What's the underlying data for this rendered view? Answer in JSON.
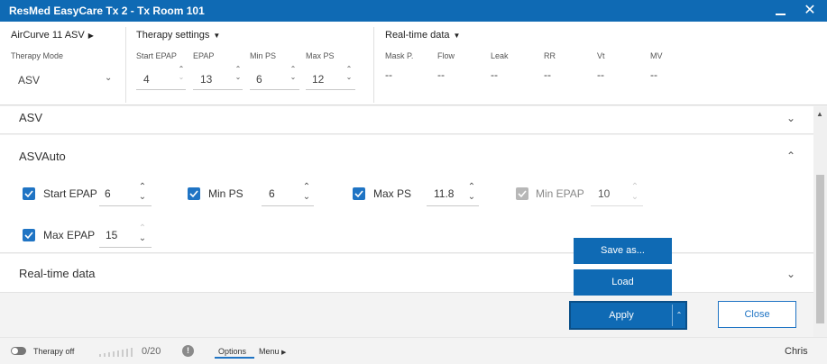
{
  "window": {
    "title": "ResMed EasyCare Tx 2 - Tx Room 101",
    "minimize": "_",
    "close": "✕"
  },
  "device": {
    "name": "AirCurve 11 ASV",
    "therapy_mode_label": "Therapy Mode",
    "therapy_mode_value": "ASV"
  },
  "therapy_settings": {
    "label": "Therapy settings",
    "fields": [
      {
        "label": "Start EPAP",
        "value": "4"
      },
      {
        "label": "EPAP",
        "value": "13"
      },
      {
        "label": "Min PS",
        "value": "6"
      },
      {
        "label": "Max PS",
        "value": "12"
      }
    ]
  },
  "realtime": {
    "label": "Real-time data",
    "columns": [
      {
        "label": "Mask P.",
        "value": "--"
      },
      {
        "label": "Flow",
        "value": "--"
      },
      {
        "label": "Leak",
        "value": "--"
      },
      {
        "label": "RR",
        "value": "--"
      },
      {
        "label": "Vt",
        "value": "--"
      },
      {
        "label": "MV",
        "value": "--"
      }
    ]
  },
  "panels": {
    "asv": {
      "title": "ASV"
    },
    "asvauto": {
      "title": "ASVAuto",
      "settings": [
        {
          "label": "Start EPAP",
          "value": "6",
          "checked": true,
          "enabled": true
        },
        {
          "label": "Min PS",
          "value": "6",
          "checked": true,
          "enabled": true
        },
        {
          "label": "Max PS",
          "value": "11.8",
          "checked": true,
          "enabled": true
        },
        {
          "label": "Min EPAP",
          "value": "10",
          "checked": true,
          "enabled": false
        },
        {
          "label": "Max EPAP",
          "value": "15",
          "checked": true,
          "enabled": true
        }
      ]
    },
    "realtime_panel": {
      "title": "Real-time data"
    }
  },
  "actions": {
    "save_as": "Save as...",
    "load": "Load",
    "apply": "Apply",
    "close": "Close"
  },
  "footer": {
    "therapy_status": "Therapy off",
    "count": "0/20",
    "options": "Options",
    "menu": "Menu",
    "user": "Chris"
  },
  "colors": {
    "primary": "#0f6ab4",
    "checkbox": "#1f74c4",
    "disabled": "#b7b7b7"
  }
}
